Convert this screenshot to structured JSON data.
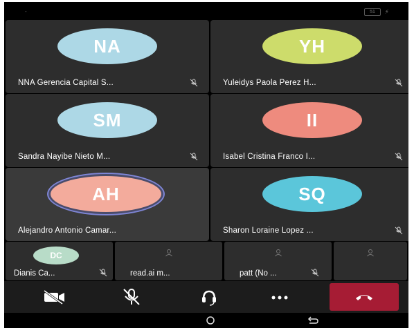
{
  "statusbar": {
    "dot": "-",
    "battery": "51"
  },
  "participants": [
    {
      "initials": "NA",
      "name": "NNA Gerencia Capital S...",
      "color": "#add8e6"
    },
    {
      "initials": "YH",
      "name": "Yuleidys Paola Perez H...",
      "color": "#cddc6b"
    },
    {
      "initials": "SM",
      "name": "Sandra Nayibe Nieto M...",
      "color": "#add8e6"
    },
    {
      "initials": "II",
      "name": "Isabel Cristina Franco I...",
      "color": "#ee8b7e"
    },
    {
      "initials": "AH",
      "name": "Alejandro Antonio Camar...",
      "color": "#f3ab9c"
    },
    {
      "initials": "SQ",
      "name": "Sharon Loraine Lopez ...",
      "color": "#5bc6da"
    }
  ],
  "strip": [
    {
      "initials": "DC",
      "name": "Dianis Ca..."
    },
    {
      "name": "read.ai m..."
    },
    {
      "name": "patt (No ..."
    }
  ],
  "colors": {
    "tile": "#2d2d2d",
    "hangup": "#a61c34",
    "controls": "#1c1c1c"
  }
}
